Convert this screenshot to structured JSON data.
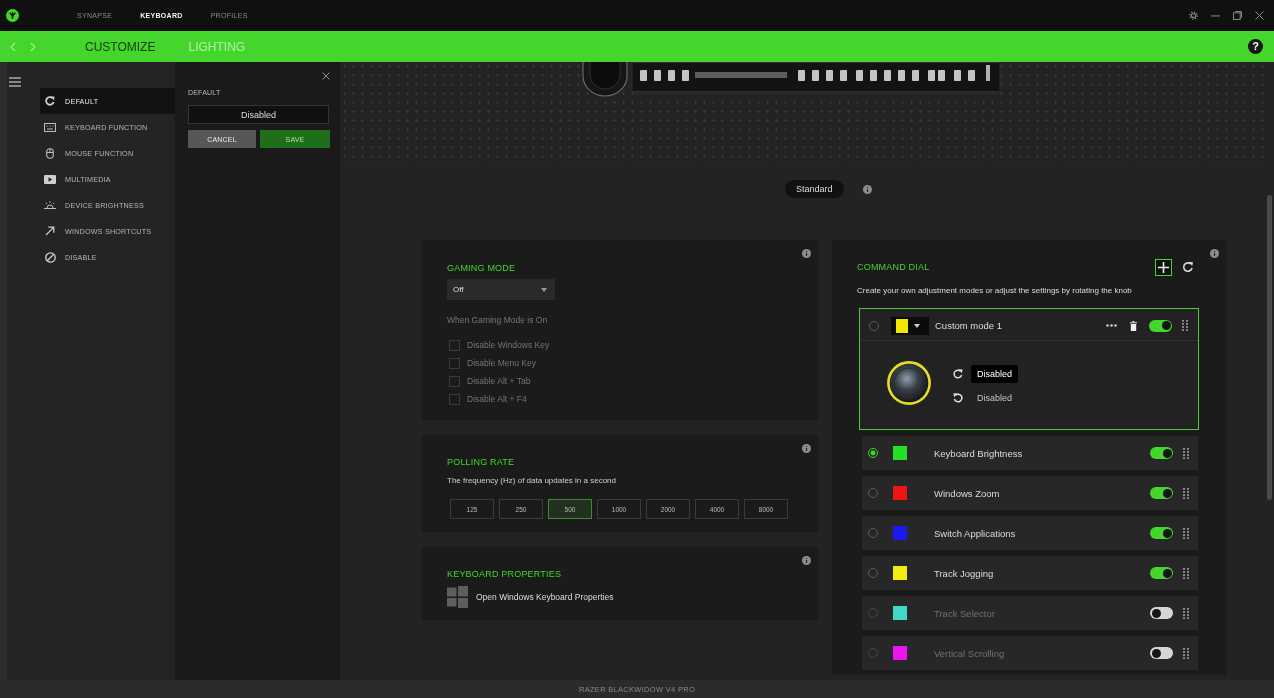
{
  "topbar": {
    "nav_tabs": [
      {
        "label": "SYNAPSE",
        "selected": false
      },
      {
        "label": "KEYBOARD",
        "selected": true
      },
      {
        "label": "PROFILES",
        "selected": false
      }
    ]
  },
  "subbar": {
    "tabs": [
      {
        "label": "CUSTOMIZE",
        "selected": true
      },
      {
        "label": "LIGHTING",
        "selected": false
      }
    ],
    "help": "?"
  },
  "sidebar": {
    "items": [
      {
        "kind": "default",
        "label": "DEFAULT",
        "selected": true
      },
      {
        "kind": "keyboard",
        "label": "KEYBOARD FUNCTION",
        "selected": false
      },
      {
        "kind": "mouse",
        "label": "MOUSE FUNCTION",
        "selected": false
      },
      {
        "kind": "multimedia",
        "label": "MULTIMEDIA",
        "selected": false
      },
      {
        "kind": "brightness",
        "label": "DEVICE BRIGHTNESS",
        "selected": false
      },
      {
        "kind": "shortcut",
        "label": "WINDOWS SHORTCUTS",
        "selected": false
      },
      {
        "kind": "disable",
        "label": "DISABLE",
        "selected": false
      }
    ]
  },
  "flyout": {
    "label": "DEFAULT",
    "value": "Disabled",
    "buttons": [
      {
        "kind": "cancel",
        "label": "CANCEL",
        "disabled": false
      },
      {
        "kind": "save",
        "label": "SAVE",
        "disabled": true
      }
    ]
  },
  "profile_mode": {
    "label": "Standard"
  },
  "gaming_mode": {
    "title": "GAMING MODE",
    "dropdown": "Off",
    "subtitle": "When Gaming Mode is On",
    "disabled": true,
    "options": [
      {
        "label": "Disable Windows Key",
        "checked": false
      },
      {
        "label": "Disable Menu Key",
        "checked": false
      },
      {
        "label": "Disable Alt + Tab",
        "checked": false
      },
      {
        "label": "Disable Alt + F4",
        "checked": false
      }
    ]
  },
  "polling_rate": {
    "title": "POLLING RATE",
    "description": "The frequency (Hz) of data updates in a second",
    "rates": [
      {
        "label": "125",
        "selected": false
      },
      {
        "label": "250",
        "selected": false
      },
      {
        "label": "500",
        "selected": true
      },
      {
        "label": "1000",
        "selected": false
      },
      {
        "label": "2000",
        "selected": false
      },
      {
        "label": "4000",
        "selected": false
      },
      {
        "label": "8000",
        "selected": false
      }
    ]
  },
  "keyboard_properties": {
    "title": "KEYBOARD PROPERTIES",
    "link": "Open Windows Keyboard Properties"
  },
  "command_dial": {
    "title": "COMMAND DIAL",
    "description": "Create your own adjustment modes or adjust the settings by rotating the knob",
    "custom_modes": [
      {
        "name": "Custom mode 1",
        "color": "#f2e600",
        "selected": false,
        "on": true,
        "expanded": true,
        "actions": [
          {
            "kind": "clockwise",
            "label": "Disabled",
            "selected": true
          },
          {
            "kind": "counterclockwise",
            "label": "Disabled",
            "selected": false
          }
        ]
      }
    ],
    "modes": [
      {
        "name": "Keyboard Brightness",
        "color": "#22e022",
        "selected": true,
        "on": true
      },
      {
        "name": "Windows Zoom",
        "color": "#f01515",
        "selected": false,
        "on": true
      },
      {
        "name": "Switch Applications",
        "color": "#1a1aee",
        "selected": false,
        "on": true
      },
      {
        "name": "Track Jogging",
        "color": "#f2ec10",
        "selected": false,
        "on": true
      },
      {
        "name": "Track Selector",
        "color": "#3fd9c8",
        "selected": false,
        "on": false
      },
      {
        "name": "Vertical Scrolling",
        "color": "#ee14ee",
        "selected": false,
        "on": false
      }
    ]
  },
  "status_bar": {
    "device": "RAZER BLACKWIDOW V4 PRO"
  }
}
